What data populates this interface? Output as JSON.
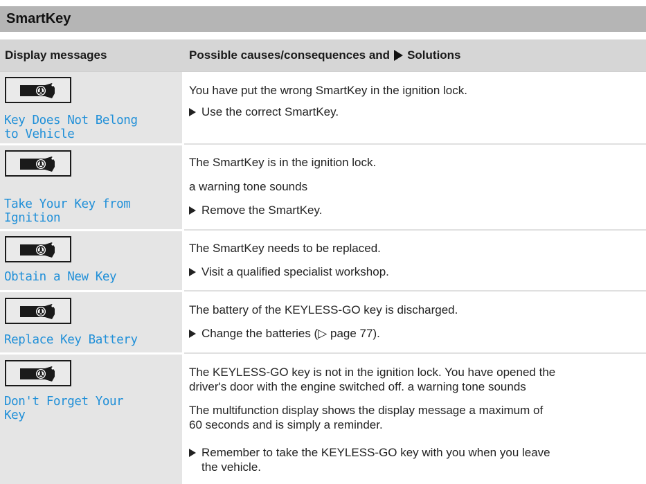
{
  "section": {
    "title": "SmartKey"
  },
  "header": {
    "col1": "Display messages",
    "col2_prefix": "Possible causes/consequences and",
    "col2_suffix": "Solutions"
  },
  "rows": [
    {
      "icon": "key-icon",
      "message_l1": "Key Does Not Belong",
      "message_l2": "to Vehicle",
      "cause": "You have put the wrong SmartKey in the ignition lock.",
      "solution": "Use the correct SmartKey."
    },
    {
      "icon": "key-icon",
      "message_l1": "Take Your Key from",
      "message_l2": "Ignition",
      "cause": "The SmartKey is in the ignition lock.",
      "cause2": "a warning tone sounds",
      "solution": "Remove the SmartKey."
    },
    {
      "icon": "key-icon",
      "message_l1": "Obtain a New Key",
      "cause": "The SmartKey needs to be replaced.",
      "solution": "Visit a qualified specialist workshop."
    },
    {
      "icon": "key-icon",
      "message_l1": "Replace Key Battery",
      "cause": "The battery of the KEYLESS-GO key is discharged.",
      "solution": "Change the batteries (▷ page 77)."
    },
    {
      "icon": "key-icon",
      "message_l1": "Don't Forget Your",
      "message_l2": "Key",
      "cause_l1": "The KEYLESS-GO key is not in the ignition lock. You have opened the",
      "cause_l2": "driver's door with the engine switched off. a warning tone sounds",
      "info_l1": "The multifunction display shows the display message a maximum of",
      "info_l2": "60 seconds and is simply a reminder.",
      "solution_l1": "Remember to take the KEYLESS-GO key with you when you leave",
      "solution_l2": "the vehicle."
    }
  ]
}
